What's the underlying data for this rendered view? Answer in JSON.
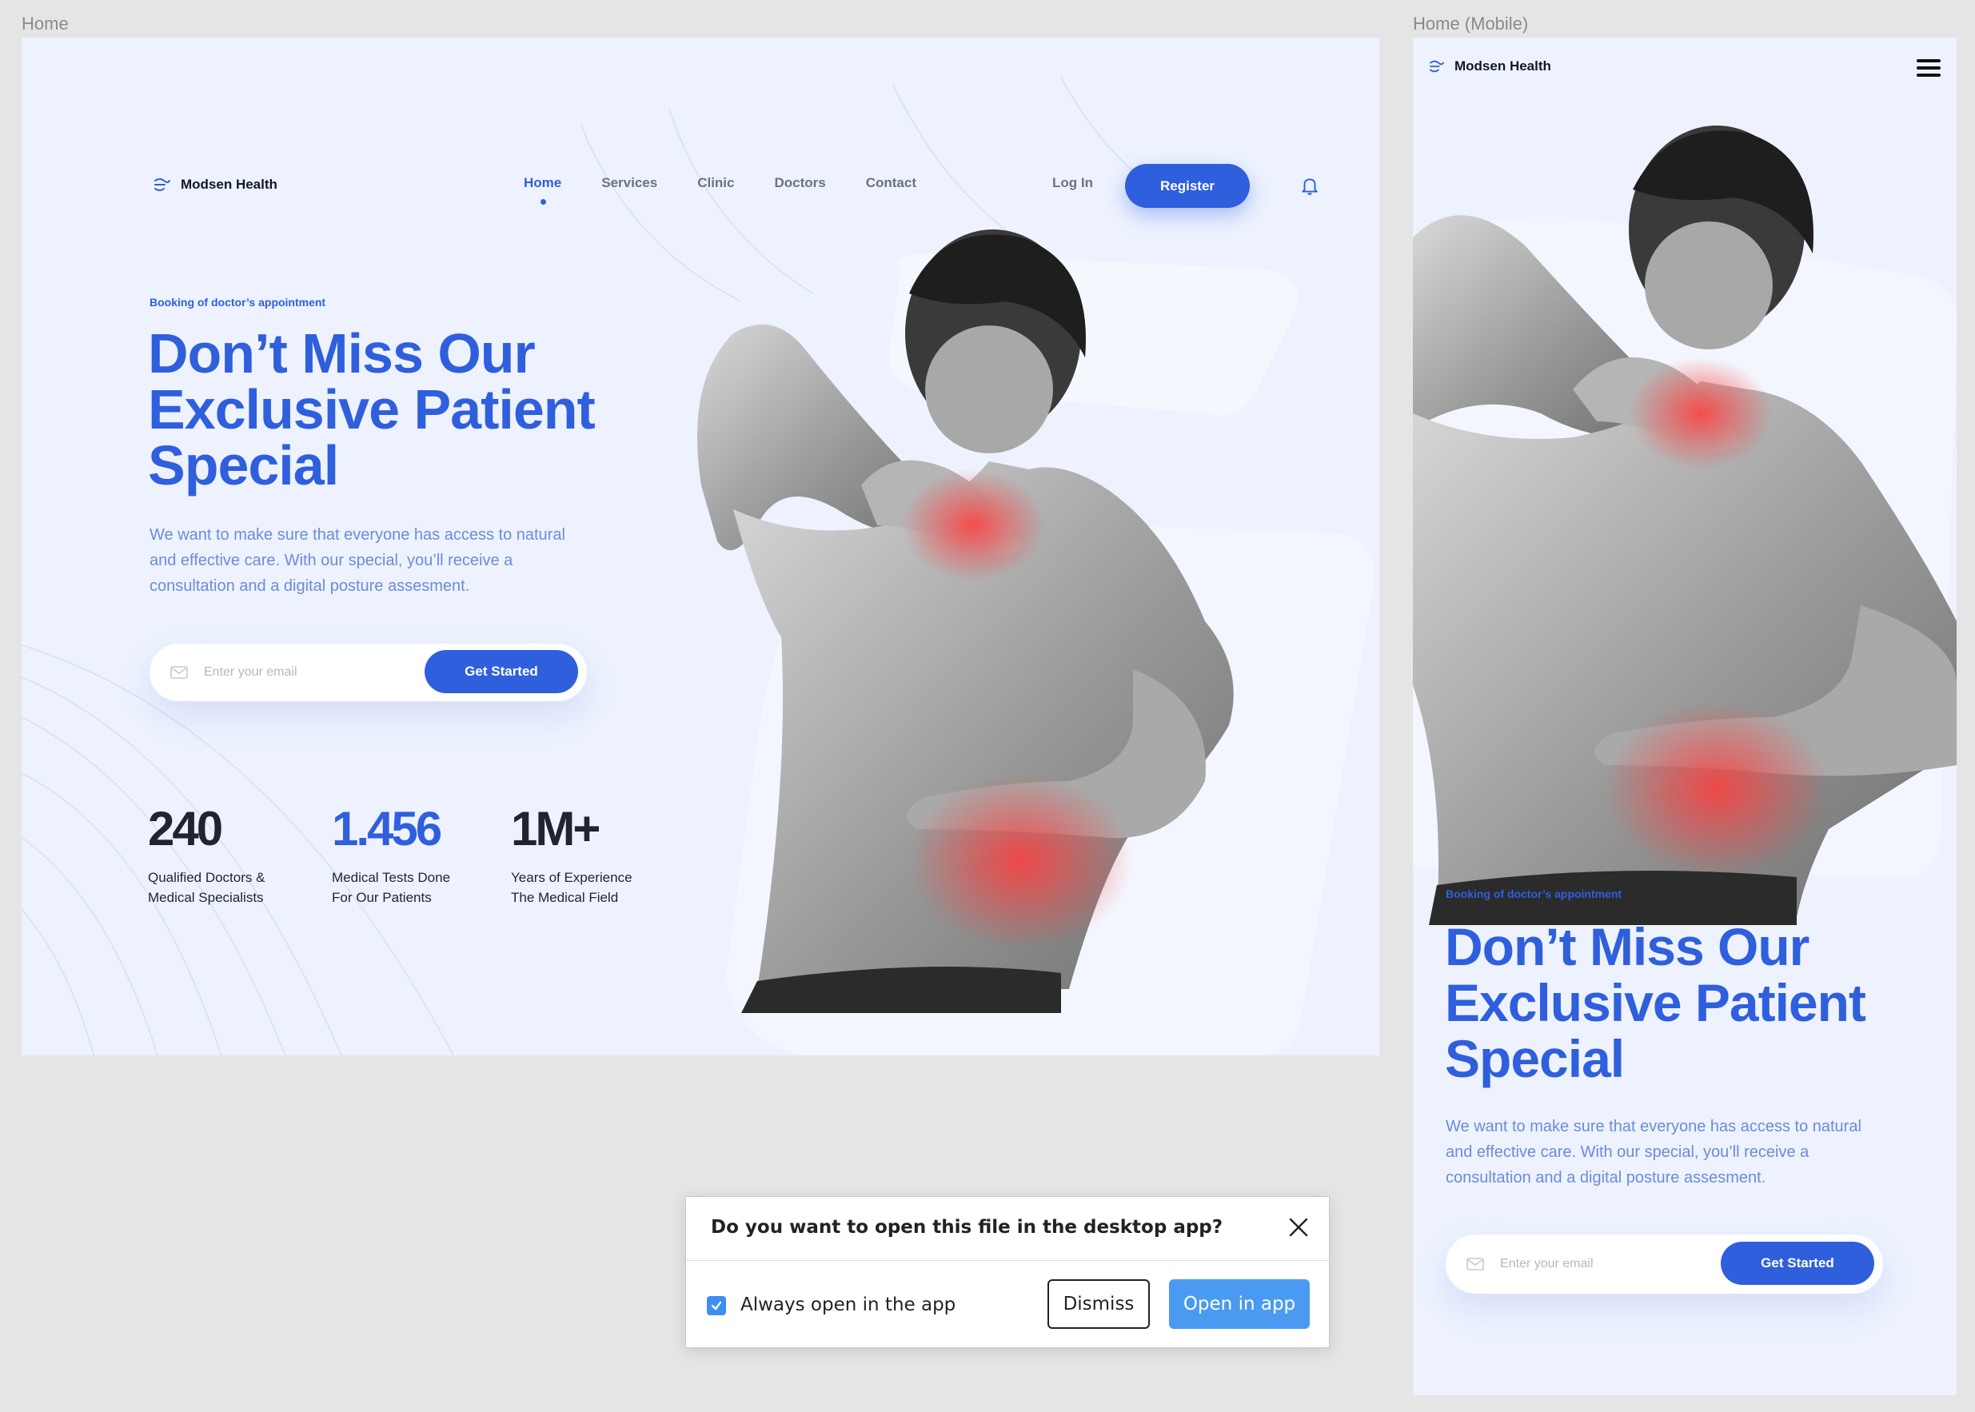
{
  "frames": {
    "desktop_label": "Home",
    "mobile_label": "Home (Mobile)"
  },
  "brand": {
    "name": "Modsen Health"
  },
  "nav": {
    "items": [
      "Home",
      "Services",
      "Clinic",
      "Doctors",
      "Contact"
    ],
    "active": "Home",
    "login": "Log In",
    "register": "Register"
  },
  "hero": {
    "eyebrow": "Booking of doctor’s appointment",
    "title_line1": "Don’t Miss Our",
    "title_line2": "Exclusive Patient",
    "title_line3": "Special",
    "lead_line1": "We want to make sure that everyone has access to natural",
    "lead_line2": "and effective care. With our special, you’ll receive a",
    "lead_line3": "consultation and a digital posture assesment.",
    "email_placeholder": "Enter your email",
    "cta": "Get Started"
  },
  "stats": [
    {
      "value": "240",
      "caption_line1": "Qualified Doctors &",
      "caption_line2": "Medical Specialists"
    },
    {
      "value": "1.456",
      "caption_line1": "Medical Tests Done",
      "caption_line2": "For Our Patients"
    },
    {
      "value": "1M+",
      "caption_line1": "Years of Experience",
      "caption_line2": "The Medical Field"
    }
  ],
  "dialog": {
    "title": "Do you want to open this file in the desktop app?",
    "checkbox_label": "Always open in the app",
    "checkbox_checked": true,
    "dismiss": "Dismiss",
    "open": "Open in app"
  },
  "colors": {
    "accent": "#2f5fdc",
    "background": "#edf2fe",
    "dialog_primary": "#4a9af2"
  }
}
